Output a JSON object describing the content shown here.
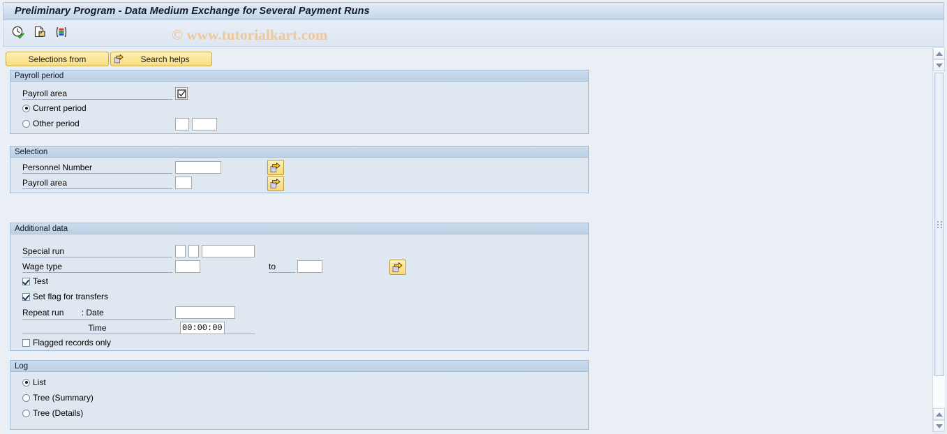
{
  "window": {
    "title": "Preliminary Program - Data Medium Exchange for Several Payment Runs",
    "watermark": "© www.tutorialkart.com"
  },
  "toolbar": {
    "icons": [
      {
        "name": "execute-clock-icon",
        "tooltip": "Execute"
      },
      {
        "name": "copy-document-icon",
        "tooltip": "Copy"
      },
      {
        "name": "color-bars-icon",
        "tooltip": "Variants"
      }
    ]
  },
  "action_buttons": {
    "selections_from": "Selections from",
    "search_helps": "Search helps"
  },
  "groups": {
    "payroll_period": {
      "title": "Payroll period",
      "payroll_area_label": "Payroll area",
      "payroll_area_value": "",
      "current_period_label": "Current period",
      "other_period_label": "Other period",
      "selected": "current_period",
      "other_period_value_1": "",
      "other_period_value_2": ""
    },
    "selection": {
      "title": "Selection",
      "personnel_number_label": "Personnel Number",
      "personnel_number_value": "",
      "payroll_area_label": "Payroll area",
      "payroll_area_value": ""
    },
    "additional_data": {
      "title": "Additional data",
      "special_run_label": "Special run",
      "special_run_value_1": "",
      "special_run_value_2": "",
      "special_run_value_3": "",
      "wage_type_label": "Wage type",
      "wage_type_from": "",
      "wage_type_to_label": "to",
      "wage_type_to": "",
      "test_label": "Test",
      "test_checked": true,
      "set_flag_label": "Set flag for transfers",
      "set_flag_checked": true,
      "repeat_run_label": "Repeat run",
      "repeat_run_date_label": ": Date",
      "repeat_run_date_value": "",
      "time_label": "Time",
      "time_value": "00:00:00",
      "flagged_records_label": "Flagged records only",
      "flagged_records_checked": false
    },
    "log": {
      "title": "Log",
      "list_label": "List",
      "tree_summary_label": "Tree (Summary)",
      "tree_details_label": "Tree (Details)",
      "selected": "list"
    }
  },
  "colors": {
    "accent_button": "#f8dd80",
    "group_header": "#bcd1e6",
    "background": "#eaeff5",
    "watermark": "#eec79b"
  }
}
